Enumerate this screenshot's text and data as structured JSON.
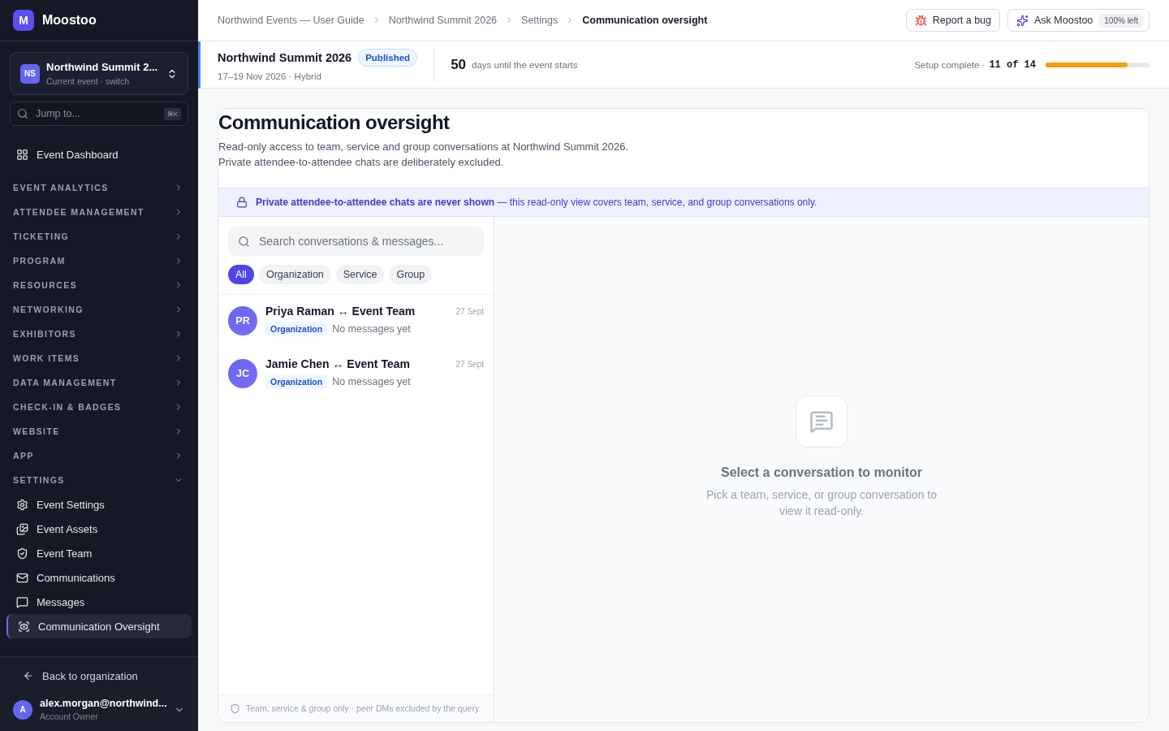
{
  "brand": {
    "logo": "M",
    "name": "Moostoo"
  },
  "event_switcher": {
    "initials": "NS",
    "name": "Northwind Summit 2...",
    "subtitle": "Current event · switch"
  },
  "jump": {
    "placeholder": "Jump to...",
    "shortcut": "⌘K"
  },
  "dashboard": {
    "label": "Event Dashboard"
  },
  "sections": [
    {
      "label": "EVENT ANALYTICS",
      "expanded": false
    },
    {
      "label": "ATTENDEE MANAGEMENT",
      "expanded": false
    },
    {
      "label": "TICKETING",
      "expanded": false
    },
    {
      "label": "PROGRAM",
      "expanded": false
    },
    {
      "label": "RESOURCES",
      "expanded": false
    },
    {
      "label": "NETWORKING",
      "expanded": false
    },
    {
      "label": "EXHIBITORS",
      "expanded": false
    },
    {
      "label": "WORK ITEMS",
      "expanded": false
    },
    {
      "label": "DATA MANAGEMENT",
      "expanded": false
    },
    {
      "label": "CHECK-IN & BADGES",
      "expanded": false
    },
    {
      "label": "WEBSITE",
      "expanded": false
    },
    {
      "label": "APP",
      "expanded": false
    },
    {
      "label": "SETTINGS",
      "expanded": true,
      "children": [
        {
          "label": "Event Settings",
          "selected": false
        },
        {
          "label": "Event Assets",
          "selected": false
        },
        {
          "label": "Event Team",
          "selected": false
        },
        {
          "label": "Communications",
          "selected": false
        },
        {
          "label": "Messages",
          "selected": false
        },
        {
          "label": "Communication Oversight",
          "selected": true
        }
      ]
    }
  ],
  "back": {
    "label": "Back to organization"
  },
  "user": {
    "initial": "A",
    "email": "alex.morgan@northwind...",
    "role": "Account Owner"
  },
  "breadcrumbs": [
    {
      "label": "Northwind Events — User Guide",
      "current": false
    },
    {
      "label": "Northwind Summit 2026",
      "current": false
    },
    {
      "label": "Settings",
      "current": false
    },
    {
      "label": "Communication oversight",
      "current": true
    }
  ],
  "report_button": {
    "label": "Report a bug"
  },
  "ask_button": {
    "label": "Ask Moostoo",
    "badge": "100% left"
  },
  "event_bar": {
    "name": "Northwind Summit 2026",
    "status": "Published",
    "dates": "17–19 Nov 2026 · Hybrid",
    "countdown": "50",
    "countdown_label": "days until the event starts",
    "setup_label": "Setup complete ·",
    "setup_count": "11 of 14",
    "level": 0.79
  },
  "page": {
    "title": "Communication oversight",
    "description": [
      "Read-only access to team, service and group conversations at Northwind Summit 2026.",
      "Private attendee-to-attendee chats are deliberately excluded."
    ]
  },
  "notice": {
    "text": "**Private attendee-to-attendee chats are never shown** — this read-only view covers team, service, and group conversations only."
  },
  "search": {
    "placeholder": "Search conversations & messages..."
  },
  "filters": [
    {
      "label": "All",
      "selected": true
    },
    {
      "label": "Organization",
      "selected": false
    },
    {
      "label": "Service",
      "selected": false
    },
    {
      "label": "Group",
      "selected": false
    }
  ],
  "conversations": [
    {
      "initials": "PR",
      "title": "Priya Raman ↔ Event Team",
      "date": "27 Sept",
      "tag": "Organization",
      "preview": "No messages yet",
      "selected": false
    },
    {
      "initials": "JC",
      "title": "Jamie Chen ↔ Event Team",
      "date": "27 Sept",
      "tag": "Organization",
      "preview": "No messages yet",
      "selected": false
    }
  ],
  "list_footer": {
    "text": "Team, service & group only · peer DMs excluded by the query"
  },
  "empty_state": {
    "title": "Select a conversation to monitor",
    "text": "Pick a team, service, or group conversation to view it read-only."
  }
}
